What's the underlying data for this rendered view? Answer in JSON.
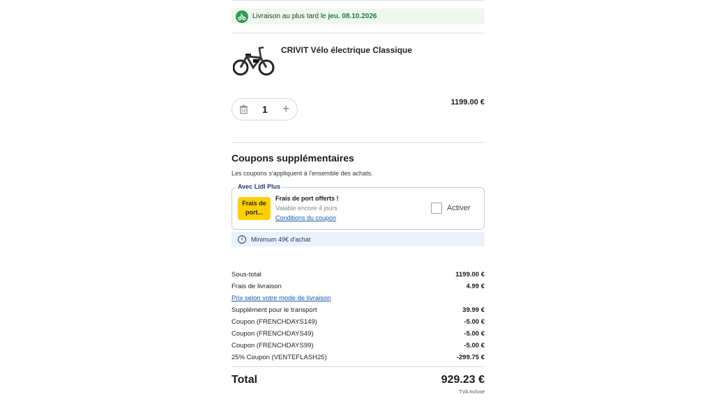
{
  "delivery": {
    "text": "Livraison au plus tard le",
    "date": "jeu. 08.10.2026"
  },
  "product": {
    "name": "CRIVIT Vélo électrique Classique",
    "quantity": "1",
    "price": "1199.00 €"
  },
  "coupons": {
    "title": "Coupons supplémentaires",
    "description": "Les coupons s'appliquent à l'ensemble des achats.",
    "group_label": "Avec Lidl Plus",
    "card": {
      "tag": "Frais de port...",
      "title": "Frais de port offerts !",
      "validity": "Valable encore 4 jours",
      "conditions_link": "Conditions du coupon",
      "activate_label": "Activer",
      "activated": false
    },
    "minimum_info": "Minimum 49€ d'achat"
  },
  "summary": {
    "rows": [
      {
        "label": "Sous-total",
        "value": "1199.00 €"
      },
      {
        "label": "Frais de livraison",
        "value": "4.99 €"
      },
      {
        "label": "Prix selon votre mode de livraison",
        "value": "",
        "link": true
      },
      {
        "label": "Supplément pour le transport",
        "value": "39.99 €"
      },
      {
        "label": "Coupon (FRENCHDAYS149)",
        "value": "-5.00 €"
      },
      {
        "label": "Coupon (FRENCHDAYS49)",
        "value": "-5.00 €"
      },
      {
        "label": "Coupon (FRENCHDAYS99)",
        "value": "-5.00 €"
      },
      {
        "label": "25% Coupon (VENTEFLASH25)",
        "value": "-299.75 €"
      }
    ],
    "total_label": "Total",
    "total_value": "929.23 €",
    "tax_note": "TVA incluse"
  },
  "colors": {
    "delivery_bg": "#eef8ef",
    "delivery_accent": "#2e9c55",
    "coupon_tag": "#ffd000",
    "link": "#1a59b2",
    "info_bg": "#eaf2fb"
  }
}
